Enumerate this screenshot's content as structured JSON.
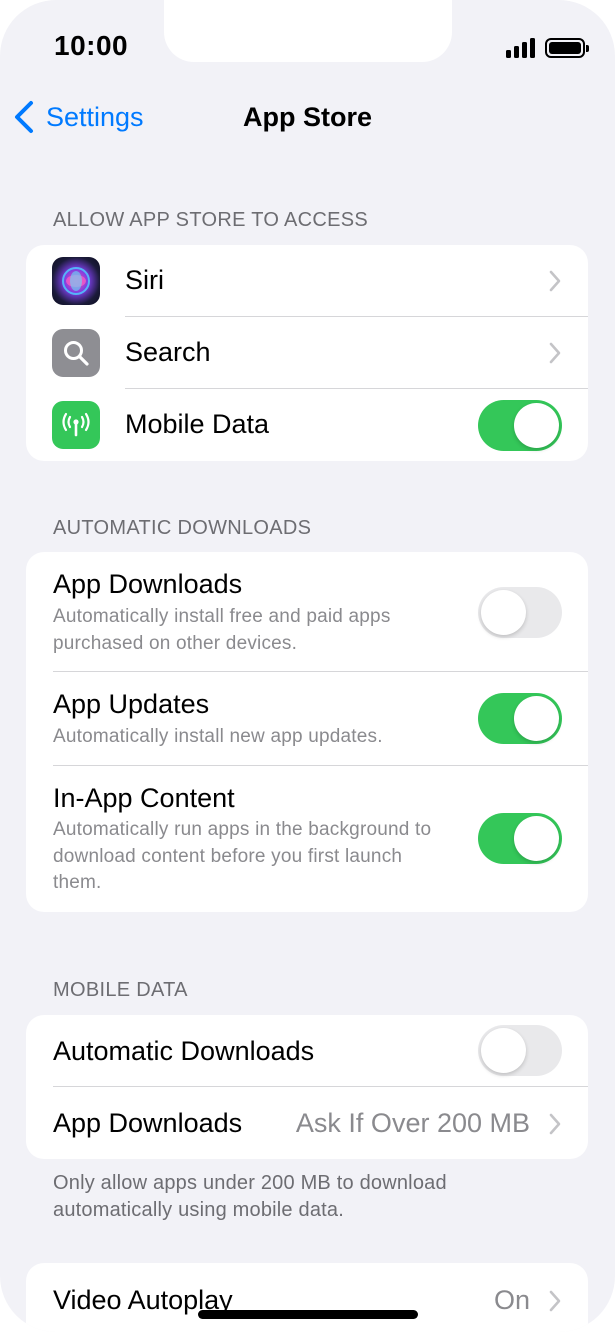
{
  "status_bar": {
    "time": "10:00"
  },
  "nav": {
    "back_label": "Settings",
    "title": "App Store"
  },
  "sections": {
    "access": {
      "header": "ALLOW APP STORE TO ACCESS",
      "rows": [
        {
          "label": "Siri",
          "icon": "siri-icon",
          "accessory": "chevron"
        },
        {
          "label": "Search",
          "icon": "search-icon",
          "accessory": "chevron"
        },
        {
          "label": "Mobile Data",
          "icon": "antenna-icon",
          "accessory": "toggle",
          "value": true
        }
      ]
    },
    "automatic_downloads": {
      "header": "AUTOMATIC DOWNLOADS",
      "rows": [
        {
          "label": "App Downloads",
          "sub_line1": "Automatically install free and paid apps",
          "sub_line2": "purchased on other devices.",
          "value": false
        },
        {
          "label": "App Updates",
          "sub_line1": "Automatically install new app updates.",
          "value": true
        },
        {
          "label": "In-App Content",
          "sub_line1": "Automatically run apps in the background to",
          "sub_line2": "download content before you first launch",
          "sub_line3": "them.",
          "value": true
        }
      ]
    },
    "mobile_data": {
      "header": "MOBILE DATA",
      "rows": [
        {
          "label": "Automatic Downloads",
          "value": false
        },
        {
          "label": "App Downloads",
          "detail": "Ask If Over 200 MB"
        }
      ],
      "footer_line1": "Only allow apps under 200 MB to download",
      "footer_line2": "automatically using mobile data."
    },
    "video": {
      "rows": [
        {
          "label": "Video Autoplay",
          "detail": "On"
        }
      ]
    }
  },
  "colors": {
    "accent": "#007aff",
    "toggle_on": "#34c759",
    "toggle_off": "#e9e9eb",
    "background": "#f2f2f7",
    "mobile_data_icon": "#34c759",
    "search_icon": "#8e8e93"
  }
}
